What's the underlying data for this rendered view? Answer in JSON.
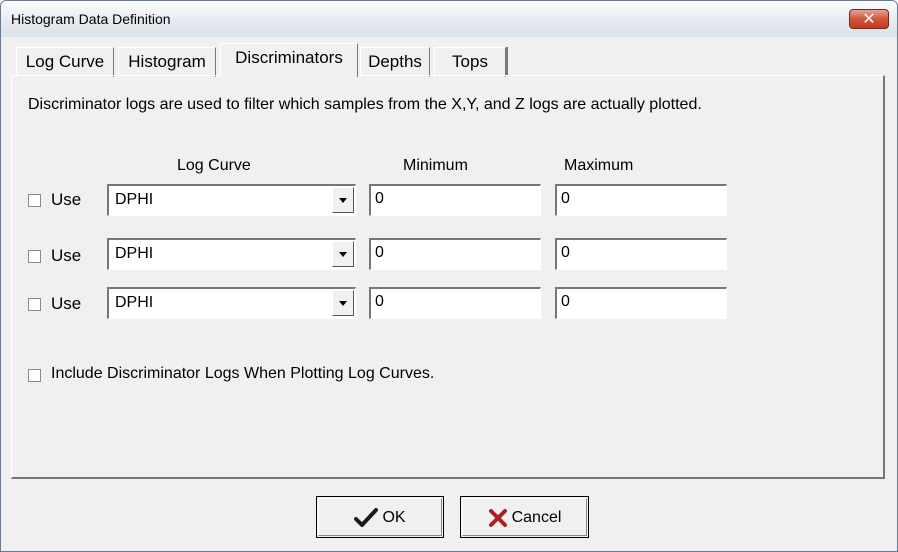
{
  "window": {
    "title": "Histogram Data Definition",
    "close_label": "✕"
  },
  "tabs": [
    {
      "label": "Log Curve"
    },
    {
      "label": "Histogram"
    },
    {
      "label": "Discriminators",
      "active": true
    },
    {
      "label": "Depths"
    },
    {
      "label": "Tops"
    }
  ],
  "discriminators": {
    "description": "Discriminator logs are used to filter which samples from the X,Y, and Z logs are actually plotted.",
    "headers": {
      "log_curve": "Log Curve",
      "minimum": "Minimum",
      "maximum": "Maximum"
    },
    "rows": [
      {
        "use_label": "Use",
        "checked": false,
        "curve": "DPHI",
        "minimum": "0",
        "maximum": "0"
      },
      {
        "use_label": "Use",
        "checked": false,
        "curve": "DPHI",
        "minimum": "0",
        "maximum": "0"
      },
      {
        "use_label": "Use",
        "checked": false,
        "curve": "DPHI",
        "minimum": "0",
        "maximum": "0"
      }
    ],
    "include_label": "Include Discriminator Logs When Plotting Log Curves.",
    "include_checked": false
  },
  "buttons": {
    "ok_label": "OK",
    "cancel_label": "Cancel"
  },
  "icons": {
    "ok": "checkmark-icon",
    "cancel": "x-icon",
    "combo": "chevron-down-icon"
  },
  "colors": {
    "ok_icon": "#1a1a1a",
    "cancel_icon": "#b01e1e",
    "close_button": "#c43a1e"
  }
}
